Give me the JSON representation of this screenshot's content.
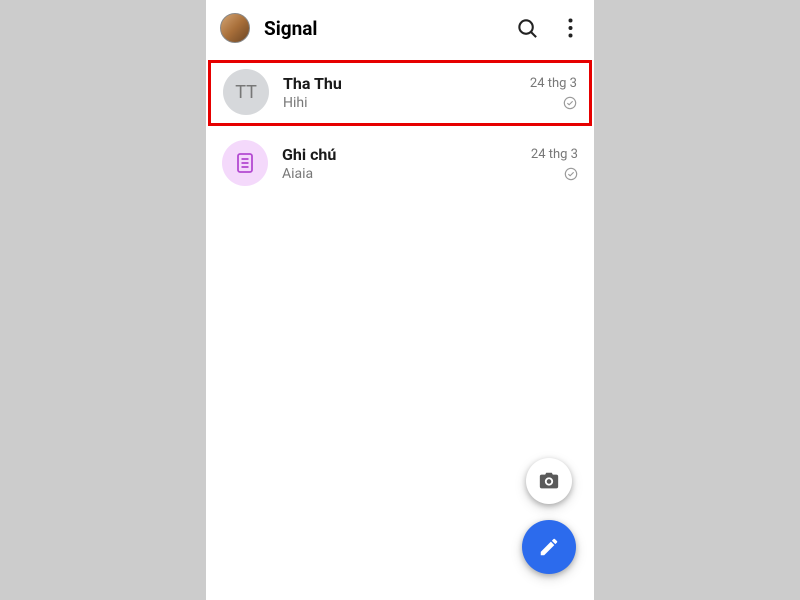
{
  "header": {
    "title": "Signal"
  },
  "conversations": [
    {
      "avatar_initials": "TT",
      "name": "Tha Thu",
      "message": "Hihi",
      "time": "24 thg 3"
    },
    {
      "name": "Ghi chú",
      "message": "Aiaia",
      "time": "24 thg 3"
    }
  ]
}
